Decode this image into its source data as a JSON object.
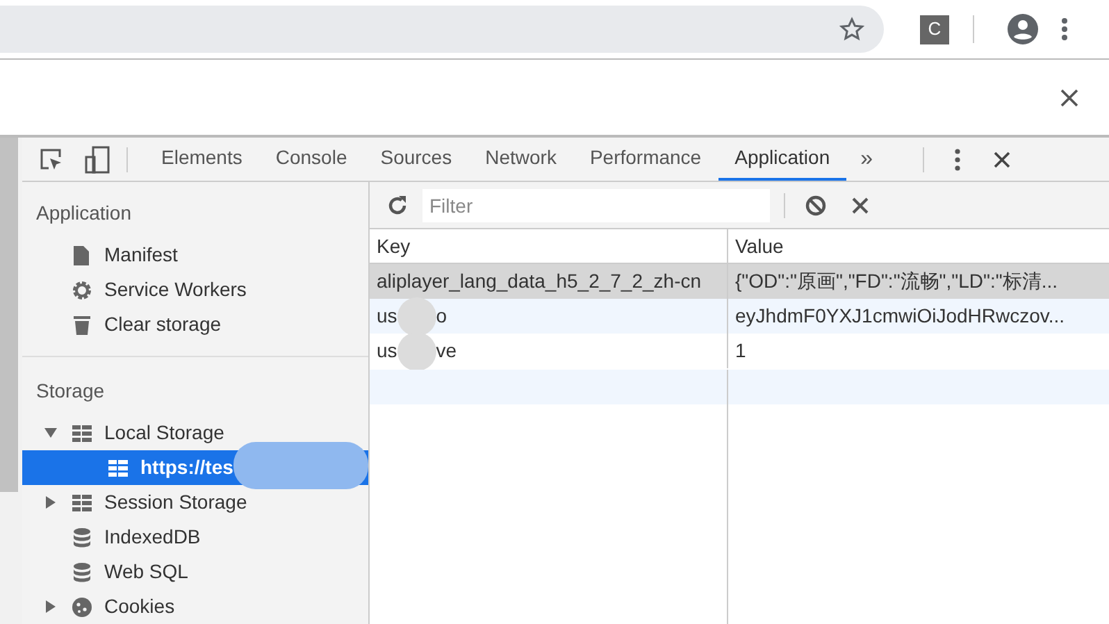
{
  "browser": {
    "extension_badge": "C"
  },
  "devtools": {
    "tabs": [
      {
        "label": "Elements",
        "selected": false
      },
      {
        "label": "Console",
        "selected": false
      },
      {
        "label": "Sources",
        "selected": false
      },
      {
        "label": "Network",
        "selected": false
      },
      {
        "label": "Performance",
        "selected": false
      },
      {
        "label": "Application",
        "selected": true
      }
    ],
    "more_tabs": "»"
  },
  "sidebar": {
    "sections": [
      {
        "title": "Application",
        "items": [
          {
            "label": "Manifest",
            "kind": "document",
            "selected": false
          },
          {
            "label": "Service Workers",
            "kind": "gear",
            "selected": false
          },
          {
            "label": "Clear storage",
            "kind": "trash",
            "selected": false
          }
        ]
      },
      {
        "title": "Storage",
        "items": [
          {
            "label": "Local Storage",
            "kind": "table",
            "selected": false,
            "expanded": true,
            "children": [
              {
                "label": "https://tes",
                "kind": "table",
                "selected": true,
                "redacted": true
              }
            ]
          },
          {
            "label": "Session Storage",
            "kind": "table",
            "selected": false,
            "expanded": false
          },
          {
            "label": "IndexedDB",
            "kind": "database",
            "selected": false
          },
          {
            "label": "Web SQL",
            "kind": "database",
            "selected": false
          },
          {
            "label": "Cookies",
            "kind": "cookie",
            "selected": false,
            "expanded": false
          }
        ]
      }
    ]
  },
  "storage_table": {
    "filter": {
      "placeholder": "Filter"
    },
    "columns": [
      "Key",
      "Value"
    ],
    "rows": [
      {
        "key_parts": [
          "aliplayer_lang_data_h5_2_7_2_zh-cn"
        ],
        "value": "{\"OD\":\"原画\",\"FD\":\"流畅\",\"LD\":\"标清...",
        "selected": true
      },
      {
        "key_parts": [
          "us",
          "o"
        ],
        "value": "eyJhdmF0YXJ1cmwiOiJodHRwczov...",
        "selected": false
      },
      {
        "key_parts": [
          "us",
          "ve"
        ],
        "value": "1",
        "selected": false
      }
    ]
  }
}
